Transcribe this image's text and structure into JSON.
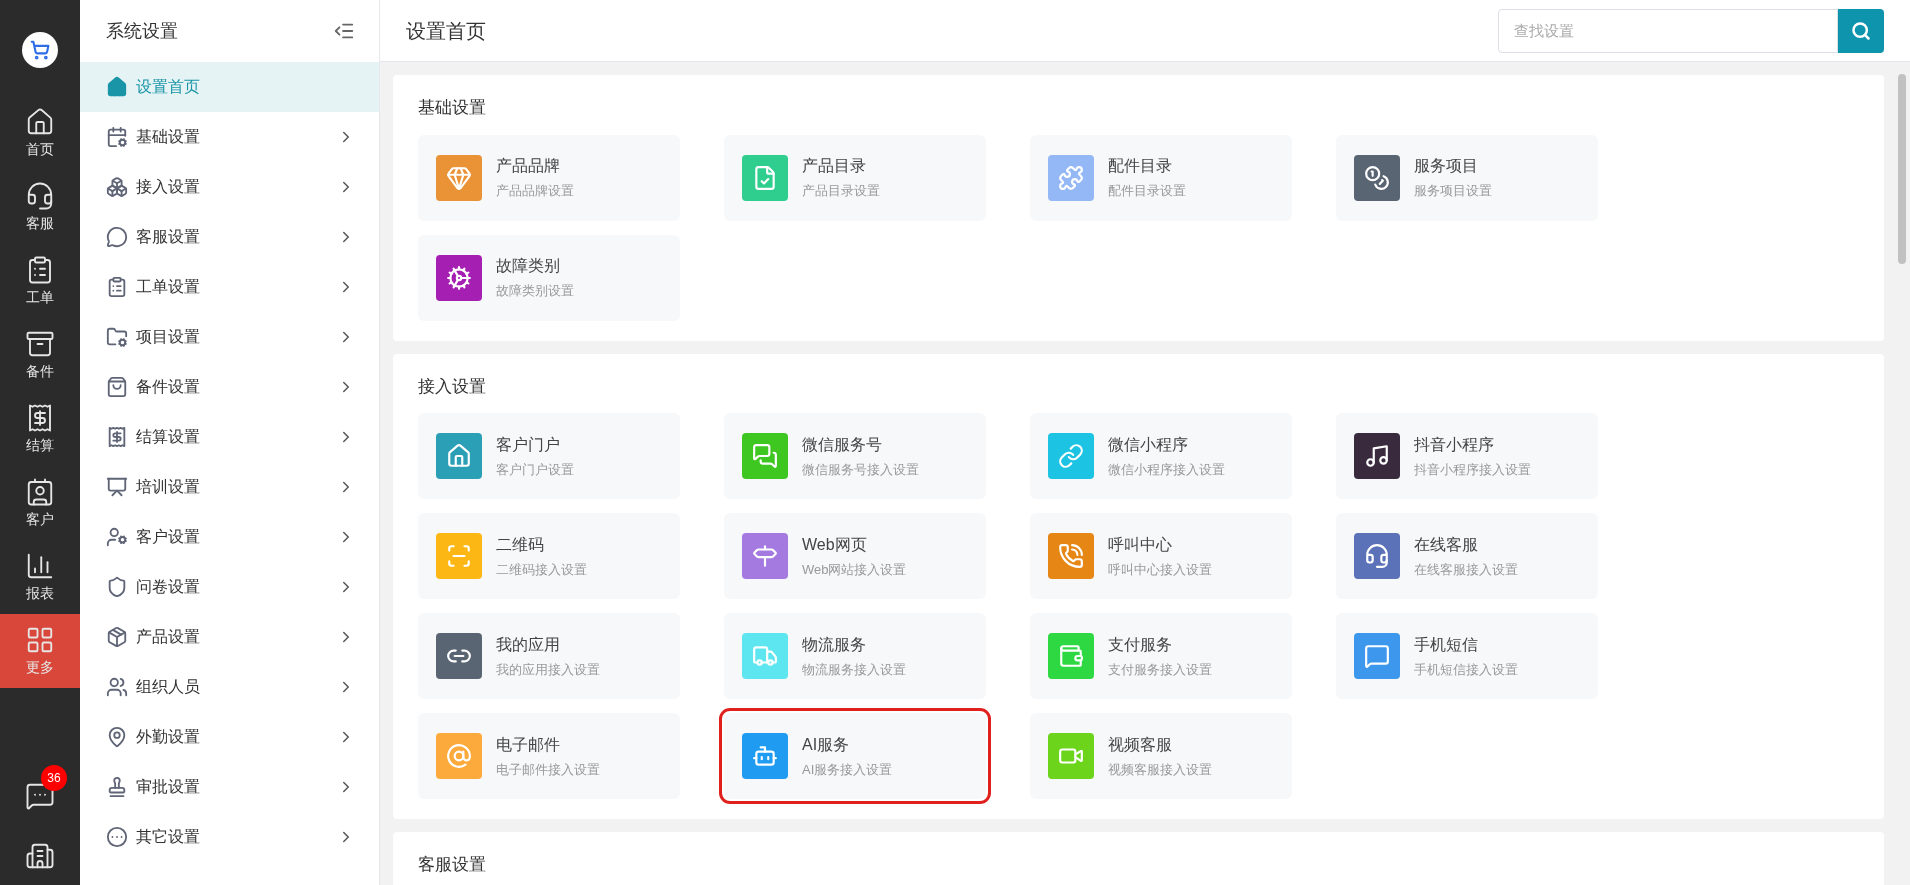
{
  "rail": {
    "items": [
      {
        "label": "首页",
        "selected": false
      },
      {
        "label": "客服",
        "selected": false
      },
      {
        "label": "工单",
        "selected": false
      },
      {
        "label": "备件",
        "selected": false
      },
      {
        "label": "结算",
        "selected": false
      },
      {
        "label": "客户",
        "selected": false
      },
      {
        "label": "报表",
        "selected": false
      },
      {
        "label": "更多",
        "selected": true
      }
    ],
    "badge": "36"
  },
  "sidebar": {
    "title": "系统设置",
    "items": [
      {
        "label": "设置首页",
        "selected": true,
        "expandable": false
      },
      {
        "label": "基础设置",
        "selected": false,
        "expandable": true
      },
      {
        "label": "接入设置",
        "selected": false,
        "expandable": true
      },
      {
        "label": "客服设置",
        "selected": false,
        "expandable": true
      },
      {
        "label": "工单设置",
        "selected": false,
        "expandable": true
      },
      {
        "label": "项目设置",
        "selected": false,
        "expandable": true
      },
      {
        "label": "备件设置",
        "selected": false,
        "expandable": true
      },
      {
        "label": "结算设置",
        "selected": false,
        "expandable": true
      },
      {
        "label": "培训设置",
        "selected": false,
        "expandable": true
      },
      {
        "label": "客户设置",
        "selected": false,
        "expandable": true
      },
      {
        "label": "问卷设置",
        "selected": false,
        "expandable": true
      },
      {
        "label": "产品设置",
        "selected": false,
        "expandable": true
      },
      {
        "label": "组织人员",
        "selected": false,
        "expandable": true
      },
      {
        "label": "外勤设置",
        "selected": false,
        "expandable": true
      },
      {
        "label": "审批设置",
        "selected": false,
        "expandable": true
      },
      {
        "label": "其它设置",
        "selected": false,
        "expandable": true
      }
    ]
  },
  "header": {
    "title": "设置首页",
    "search": {
      "placeholder": "查找设置"
    }
  },
  "sections": [
    {
      "title": "基础设置",
      "cards": [
        {
          "title": "产品品牌",
          "subtitle": "产品品牌设置",
          "color": "#ea9236",
          "highlighted": false
        },
        {
          "title": "产品目录",
          "subtitle": "产品目录设置",
          "color": "#2fce8e",
          "highlighted": false
        },
        {
          "title": "配件目录",
          "subtitle": "配件目录设置",
          "color": "#94b8f5",
          "highlighted": false
        },
        {
          "title": "服务项目",
          "subtitle": "服务项目设置",
          "color": "#5a6573",
          "highlighted": false
        },
        {
          "title": "故障类别",
          "subtitle": "故障类别设置",
          "color": "#a51fb3",
          "highlighted": false
        }
      ]
    },
    {
      "title": "接入设置",
      "cards": [
        {
          "title": "客户门户",
          "subtitle": "客户门户设置",
          "color": "#2a9fb5",
          "highlighted": false
        },
        {
          "title": "微信服务号",
          "subtitle": "微信服务号接入设置",
          "color": "#3ec621",
          "highlighted": false
        },
        {
          "title": "微信小程序",
          "subtitle": "微信小程序接入设置",
          "color": "#1cc3e3",
          "highlighted": false
        },
        {
          "title": "抖音小程序",
          "subtitle": "抖音小程序接入设置",
          "color": "#3a2a3e",
          "highlighted": false
        },
        {
          "title": "二维码",
          "subtitle": "二维码接入设置",
          "color": "#fdb714",
          "highlighted": false
        },
        {
          "title": "Web网页",
          "subtitle": "Web网站接入设置",
          "color": "#a57ae0",
          "highlighted": false
        },
        {
          "title": "呼叫中心",
          "subtitle": "呼叫中心接入设置",
          "color": "#e58615",
          "highlighted": false
        },
        {
          "title": "在线客服",
          "subtitle": "在线客服接入设置",
          "color": "#5b72b8",
          "highlighted": false
        },
        {
          "title": "我的应用",
          "subtitle": "我的应用接入设置",
          "color": "#5a6573",
          "highlighted": false
        },
        {
          "title": "物流服务",
          "subtitle": "物流服务接入设置",
          "color": "#5ee6f0",
          "highlighted": false
        },
        {
          "title": "支付服务",
          "subtitle": "支付服务接入设置",
          "color": "#2ed843",
          "highlighted": false
        },
        {
          "title": "手机短信",
          "subtitle": "手机短信接入设置",
          "color": "#3d97ec",
          "highlighted": false
        },
        {
          "title": "电子邮件",
          "subtitle": "电子邮件接入设置",
          "color": "#fdaa3c",
          "highlighted": false
        },
        {
          "title": "AI服务",
          "subtitle": "AI服务接入设置",
          "color": "#1f9cf2",
          "highlighted": true
        },
        {
          "title": "视频客服",
          "subtitle": "视频客服接入设置",
          "color": "#6cd41b",
          "highlighted": false
        }
      ]
    },
    {
      "title": "客服设置"
    }
  ]
}
